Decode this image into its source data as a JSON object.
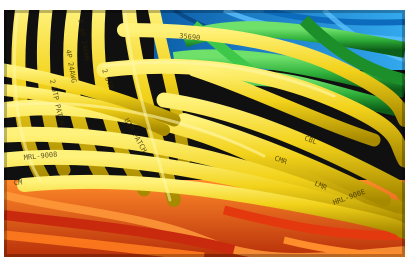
{
  "image": {
    "subject": "cables-photo",
    "palette": {
      "yellow": "#f2d21a",
      "yellow_dark": "#b89a05",
      "green": "#2fb03a",
      "green_dark": "#137a22",
      "blue": "#1d8fd6",
      "orange": "#f26a12",
      "red": "#d8281a"
    },
    "cable_print_texts": [
      "4P 24AWG",
      "2 UTP PATCH",
      "F 4P 24AWG",
      "MRL-9008",
      "CM",
      "35690",
      "HRL-900E",
      "CBL",
      "LMR",
      "CMR",
      "UTP PATCH",
      "2 UTP"
    ]
  }
}
